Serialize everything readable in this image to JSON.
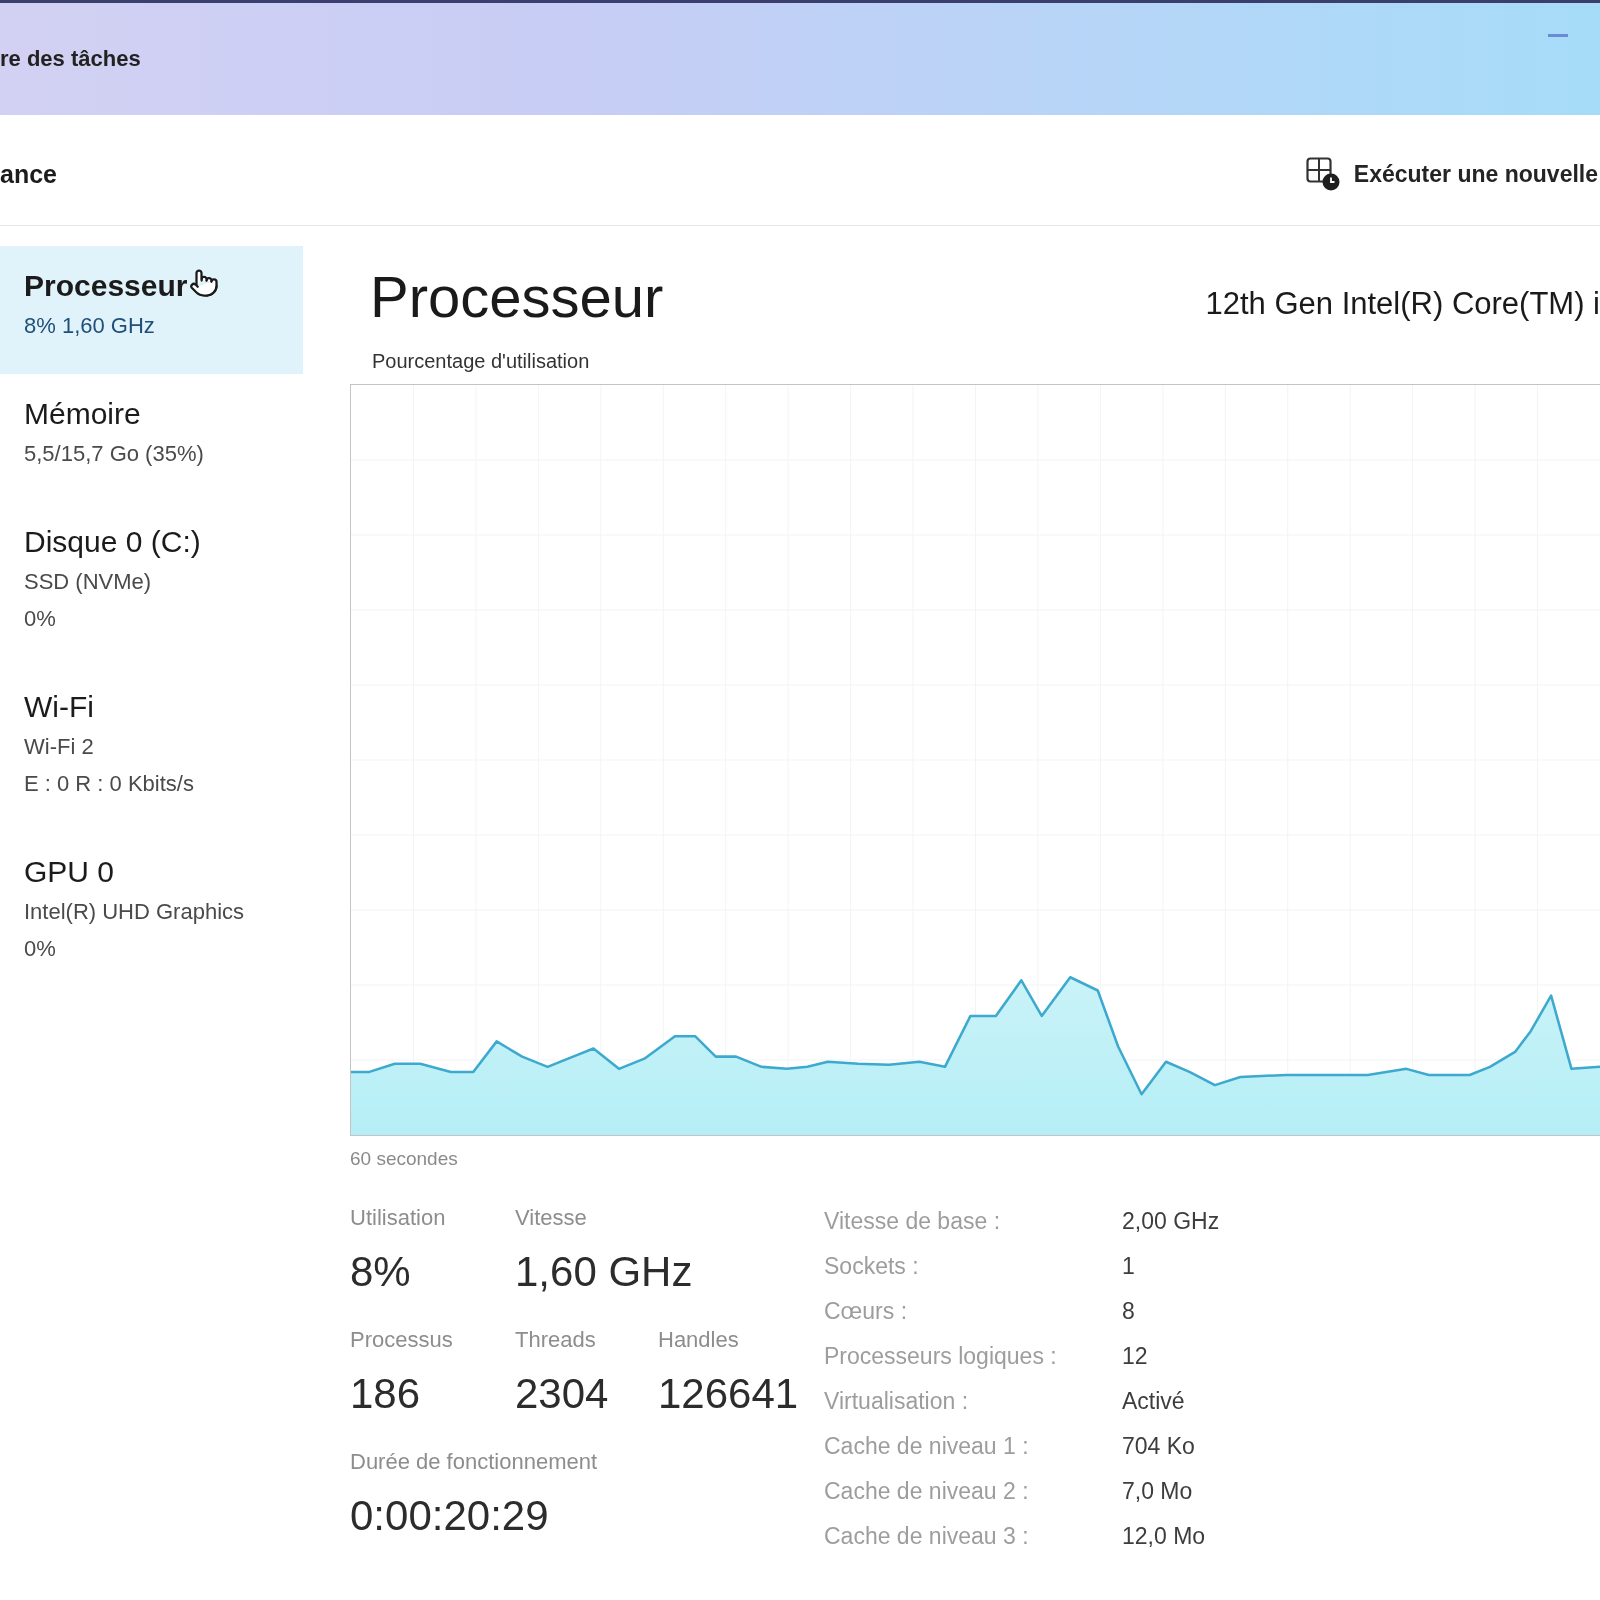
{
  "window": {
    "title": "re des tâches"
  },
  "toolbar": {
    "section_title": "ance",
    "run_task": {
      "label": "Exécuter une nouvelle"
    }
  },
  "sidebar": {
    "items": [
      {
        "title": "Processeur",
        "lines": [
          "8% 1,60 GHz"
        ],
        "selected": true,
        "hovered": true
      },
      {
        "title": "Mémoire",
        "lines": [
          "5,5/15,7 Go (35%)"
        ],
        "selected": false,
        "hovered": false
      },
      {
        "title": "Disque 0 (C:)",
        "lines": [
          "SSD (NVMe)",
          "0%"
        ],
        "selected": false,
        "hovered": false
      },
      {
        "title": "Wi-Fi",
        "lines": [
          "Wi-Fi 2",
          "E : 0 R : 0 Kbits/s"
        ],
        "selected": false,
        "hovered": false
      },
      {
        "title": "GPU 0",
        "lines": [
          "Intel(R) UHD Graphics",
          "0%"
        ],
        "selected": false,
        "hovered": false
      }
    ]
  },
  "panel": {
    "title": "Processeur",
    "device": "12th Gen Intel(R) Core(TM) i",
    "graph_label": "Pourcentage d'utilisation",
    "time_span": "60 secondes",
    "stats": [
      [
        {
          "label": "Utilisation",
          "value": "8%"
        },
        {
          "label": "Vitesse",
          "value": "1,60 GHz"
        }
      ],
      [
        {
          "label": "Processus",
          "value": "186"
        },
        {
          "label": "Threads",
          "value": "2304"
        },
        {
          "label": "Handles",
          "value": "126641"
        }
      ],
      [
        {
          "label": "Durée de fonctionnement",
          "value": "0:00:20:29"
        }
      ]
    ],
    "details": [
      {
        "label": "Vitesse de base :",
        "value": "2,00 GHz"
      },
      {
        "label": "Sockets :",
        "value": "1"
      },
      {
        "label": "Cœurs :",
        "value": "8"
      },
      {
        "label": "Processeurs logiques :",
        "value": "12"
      },
      {
        "label": "Virtualisation :",
        "value": "Activé"
      },
      {
        "label": "Cache de niveau 1 :",
        "value": "704 Ko"
      },
      {
        "label": "Cache de niveau 2 :",
        "value": "7,0 Mo"
      },
      {
        "label": "Cache de niveau 3 :",
        "value": "12,0 Mo"
      }
    ]
  }
}
